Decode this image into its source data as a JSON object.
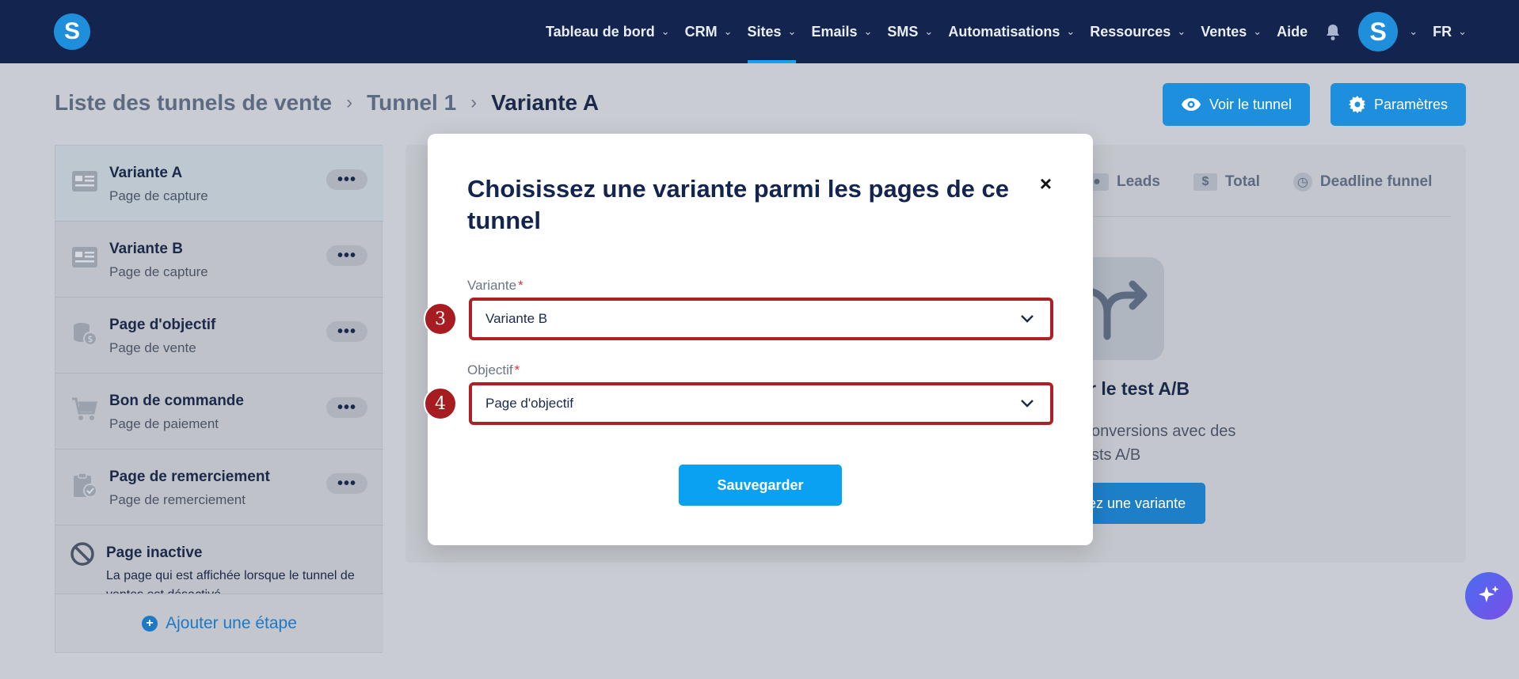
{
  "nav": {
    "logo_letter": "S",
    "items": [
      {
        "label": "Tableau de bord",
        "has_dropdown": true
      },
      {
        "label": "CRM",
        "has_dropdown": true
      },
      {
        "label": "Sites",
        "has_dropdown": true,
        "active": true
      },
      {
        "label": "Emails",
        "has_dropdown": true
      },
      {
        "label": "SMS",
        "has_dropdown": true
      },
      {
        "label": "Automatisations",
        "has_dropdown": true
      },
      {
        "label": "Ressources",
        "has_dropdown": true
      },
      {
        "label": "Ventes",
        "has_dropdown": true
      },
      {
        "label": "Aide",
        "has_dropdown": false
      }
    ],
    "avatar_letter": "S",
    "language": "FR",
    "accent_color": "#16a2ee"
  },
  "breadcrumb": {
    "items": [
      "Liste des tunnels de vente",
      "Tunnel 1",
      "Variante A"
    ]
  },
  "header_buttons": {
    "view_label": "Voir le tunnel",
    "params_label": "Paramètres"
  },
  "sidebar": {
    "items": [
      {
        "title": "Variante A",
        "subtitle": "Page de capture",
        "icon": "form-card-icon",
        "selected": true
      },
      {
        "title": "Variante B",
        "subtitle": "Page de capture",
        "icon": "form-card-icon"
      },
      {
        "title": "Page d'objectif",
        "subtitle": "Page de vente",
        "icon": "coins-icon"
      },
      {
        "title": "Bon de commande",
        "subtitle": "Page de paiement",
        "icon": "cart-icon"
      },
      {
        "title": "Page de remerciement",
        "subtitle": "Page de remerciement",
        "icon": "clipboard-check-icon"
      }
    ],
    "more_label": "•••",
    "inactive": {
      "title": "Page inactive",
      "description": "La page qui est affichée lorsque le tunnel de ventes est désactivé"
    },
    "add_step_label": "Ajouter une étape"
  },
  "background_panel": {
    "tabs": [
      {
        "label": "Leads",
        "icon": "user-icon"
      },
      {
        "label": "Total",
        "icon": "dollar-icon"
      },
      {
        "label": "Deadline funnel",
        "icon": "clock-icon"
      }
    ],
    "ab_title": "r le test A/B",
    "ab_desc_line1": "onversions avec des",
    "ab_desc_line2": "sts A/B",
    "ab_button": "ez une variante"
  },
  "modal": {
    "title": "Choisissez une variante parmi les pages de ce tunnel",
    "close_symbol": "×",
    "variant_label": "Variante",
    "variant_value": "Variante B",
    "objective_label": "Objectif",
    "objective_value": "Page d'objectif",
    "required_mark": "*",
    "save_label": "Sauvegarder",
    "step_badges": [
      "3",
      "4"
    ]
  }
}
